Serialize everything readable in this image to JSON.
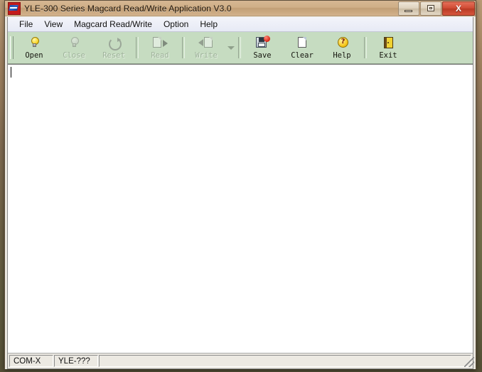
{
  "window": {
    "title": "YLE-300 Series Magcard Read/Write Application V3.0",
    "app_icon_name": "magcard-app-icon",
    "controls": {
      "minimize_label": "–",
      "maximize_label": "□",
      "close_label": "X"
    }
  },
  "menubar": {
    "items": [
      {
        "label": "File"
      },
      {
        "label": "View"
      },
      {
        "label": "Magcard Read/Write"
      },
      {
        "label": "Option"
      },
      {
        "label": "Help"
      }
    ]
  },
  "toolbar": {
    "buttons": [
      {
        "label": "Open",
        "icon": "lightbulb-icon",
        "enabled": true
      },
      {
        "label": "Close",
        "icon": "lightbulb-off-icon",
        "enabled": false
      },
      {
        "label": "Reset",
        "icon": "refresh-icon",
        "enabled": false
      },
      {
        "label": "Read",
        "icon": "read-card-icon",
        "enabled": false
      },
      {
        "label": "Write",
        "icon": "write-card-icon",
        "enabled": false
      },
      {
        "label": "Save",
        "icon": "floppy-save-icon",
        "enabled": true
      },
      {
        "label": "Clear",
        "icon": "blank-page-icon",
        "enabled": true
      },
      {
        "label": "Help",
        "icon": "question-mark-icon",
        "enabled": true
      },
      {
        "label": "Exit",
        "icon": "exit-door-icon",
        "enabled": true
      }
    ],
    "write_dropdown_icon": "chevron-down-icon"
  },
  "editor": {
    "content": "",
    "placeholder": ""
  },
  "statusbar": {
    "panels": [
      {
        "text": "COM-X"
      },
      {
        "text": "YLE-???"
      },
      {
        "text": ""
      }
    ]
  },
  "colors": {
    "toolbar_bg": "#c6dcc1",
    "titlebar_bg": "#cfae87",
    "close_button": "#cf4a33",
    "menubar_bg": "#e7eaf5",
    "editor_bg": "#ffffff"
  }
}
